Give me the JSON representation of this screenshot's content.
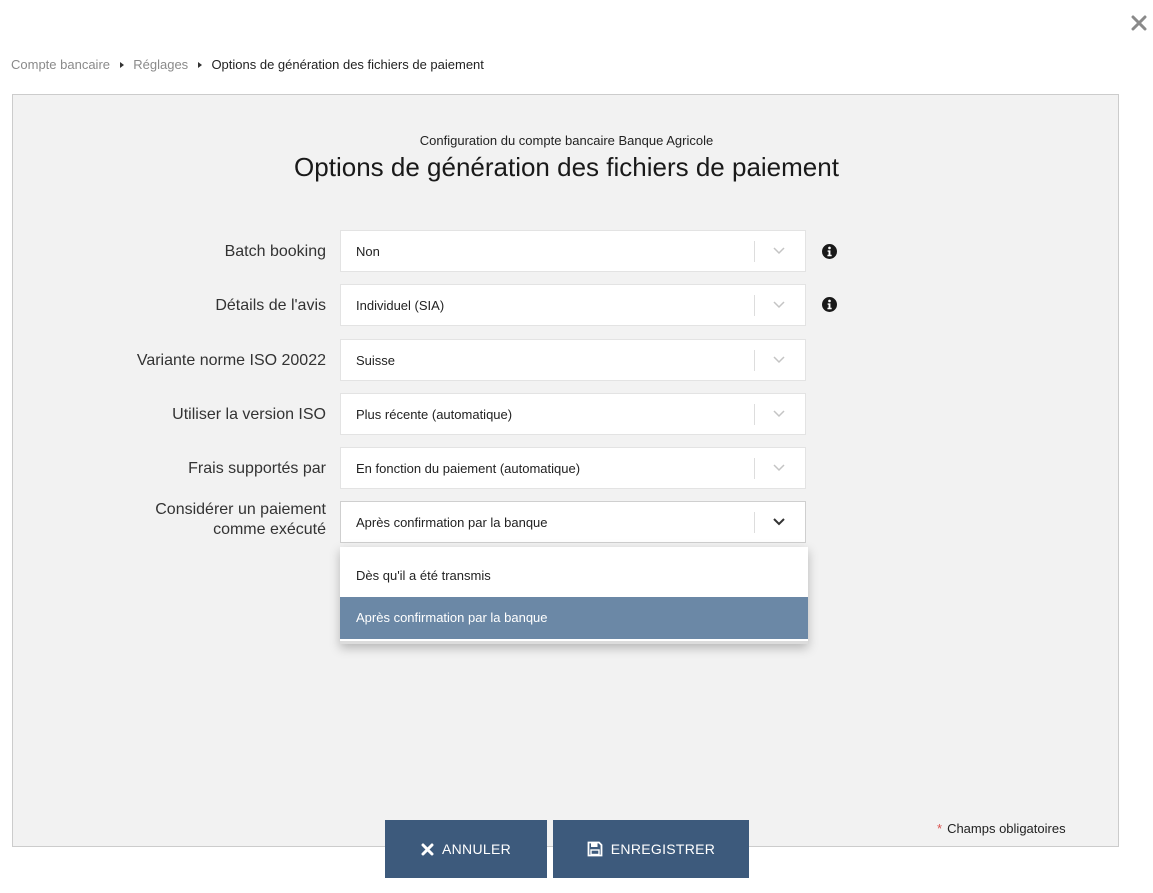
{
  "breadcrumb": {
    "items": [
      "Compte bancaire",
      "Réglages"
    ],
    "current": "Options de génération des fichiers de paiement"
  },
  "header": {
    "subtitle": "Configuration du compte bancaire Banque Agricole",
    "title": "Options de génération des fichiers de paiement"
  },
  "form": {
    "rows": [
      {
        "label": "Batch booking",
        "value": "Non"
      },
      {
        "label": "Détails de l'avis",
        "value": "Individuel (SIA)"
      },
      {
        "label": "Variante norme ISO 20022",
        "value": "Suisse"
      },
      {
        "label": "Utiliser la version ISO",
        "value": "Plus récente (automatique)"
      },
      {
        "label": "Frais supportés par",
        "value": "En fonction du paiement (automatique)"
      },
      {
        "label_line1": "Considérer un paiement",
        "label_line2": "comme exécuté",
        "value": "Après confirmation par la banque"
      }
    ],
    "dropdown_options": [
      "Dès qu'il a été transmis",
      "Après confirmation par la banque"
    ]
  },
  "footer": {
    "required_star": "*",
    "required_text": "Champs obligatoires"
  },
  "buttons": {
    "cancel": "ANNULER",
    "save": "ENREGISTRER"
  },
  "icons": {
    "close": "close-icon",
    "info": "info-icon",
    "chevron": "chevron-down-icon",
    "cancel": "close-icon",
    "save": "floppy-disk-icon"
  },
  "colors": {
    "panel_background": "#f2f2f2",
    "button_background": "#3d5a7c",
    "selected_option": "#6b88a6",
    "required_star": "#d9534f"
  }
}
